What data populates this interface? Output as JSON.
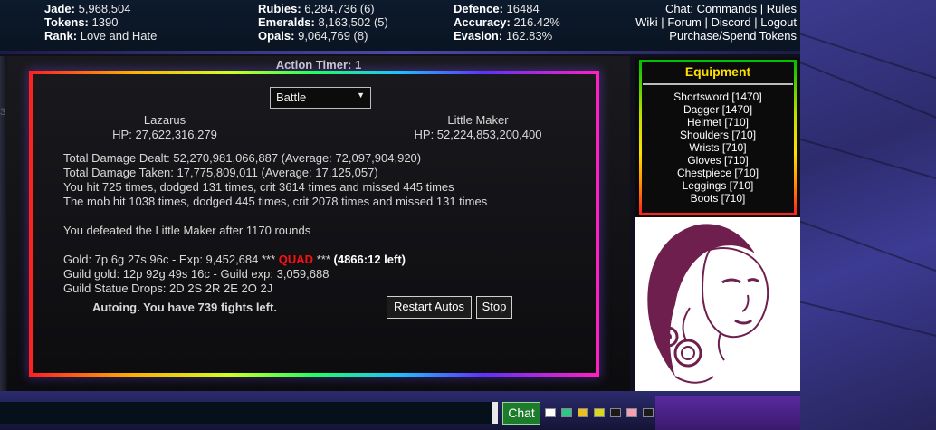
{
  "stats": {
    "col1": [
      {
        "label": "Jade:",
        "value": "5,968,504"
      },
      {
        "label": "Tokens:",
        "value": "1390"
      },
      {
        "label": "Rank:",
        "value": "Love and Hate"
      }
    ],
    "col2": [
      {
        "label": "Rubies:",
        "value": "6,284,736 (6)"
      },
      {
        "label": "Emeralds:",
        "value": "8,163,502 (5)"
      },
      {
        "label": "Opals:",
        "value": "9,064,769 (8)"
      }
    ],
    "col3": [
      {
        "label": "Defence:",
        "value": "16484"
      },
      {
        "label": "Accuracy:",
        "value": "216.42%"
      },
      {
        "label": "Evasion:",
        "value": "162.83%"
      }
    ]
  },
  "links": {
    "chat": "Chat:",
    "commands": "Commands",
    "rules": "Rules",
    "wiki": "Wiki",
    "forum": "Forum",
    "discord": "Discord",
    "logout": "Logout",
    "purchase": "Purchase/Spend Tokens",
    "sep": "|"
  },
  "battle": {
    "timer": "Action Timer: 1",
    "mode": "Battle",
    "player": {
      "name": "Lazarus",
      "hp": "HP: 27,622,316,279"
    },
    "enemy": {
      "name": "Little Maker",
      "hp": "HP: 52,224,853,200,400"
    },
    "log": [
      "Total Damage Dealt: 52,270,981,066,887 (Average: 72,097,904,920)",
      "Total Damage Taken: 17,775,809,011 (Average: 17,125,057)",
      "You hit 725 times, dodged 131 times, crit 3614 times and missed 445 times",
      "The mob hit 1038 times, dodged 445 times, crit 2078 times and missed 131 times"
    ],
    "defeated": "You defeated the Little Maker after 1170 rounds",
    "gold_line": {
      "prefix": "Gold: 7p 6g 27s 96c - Exp: 9,452,684 ***",
      "quad": "QUAD",
      "mid": "***",
      "left": "(4866:12 left)"
    },
    "guild_gold": "Guild gold: 12p 92g 49s 16c - Guild exp: 3,059,688",
    "statue_drops": "Guild Statue Drops: 2D 2S 2R 2E 2O 2J",
    "autoing": "Autoing. You have 739 fights left.",
    "restart_label": "Restart Autos",
    "stop_label": "Stop"
  },
  "equipment": {
    "title": "Equipment",
    "items": [
      "Shortsword [1470]",
      "Dagger [1470]",
      "Helmet [710]",
      "Shoulders [710]",
      "Wrists [710]",
      "Gloves [710]",
      "Chestpiece [710]",
      "Leggings [710]",
      "Boots [710]"
    ]
  },
  "chat": {
    "button": "Chat",
    "swatches": [
      "#ffffff",
      "#2fc48a",
      "#e8c020",
      "#d8d820",
      "#1a1a1a",
      "#1a1a1a",
      "#f4a0b0",
      "#1a1a1a"
    ]
  },
  "left_mark": "3"
}
